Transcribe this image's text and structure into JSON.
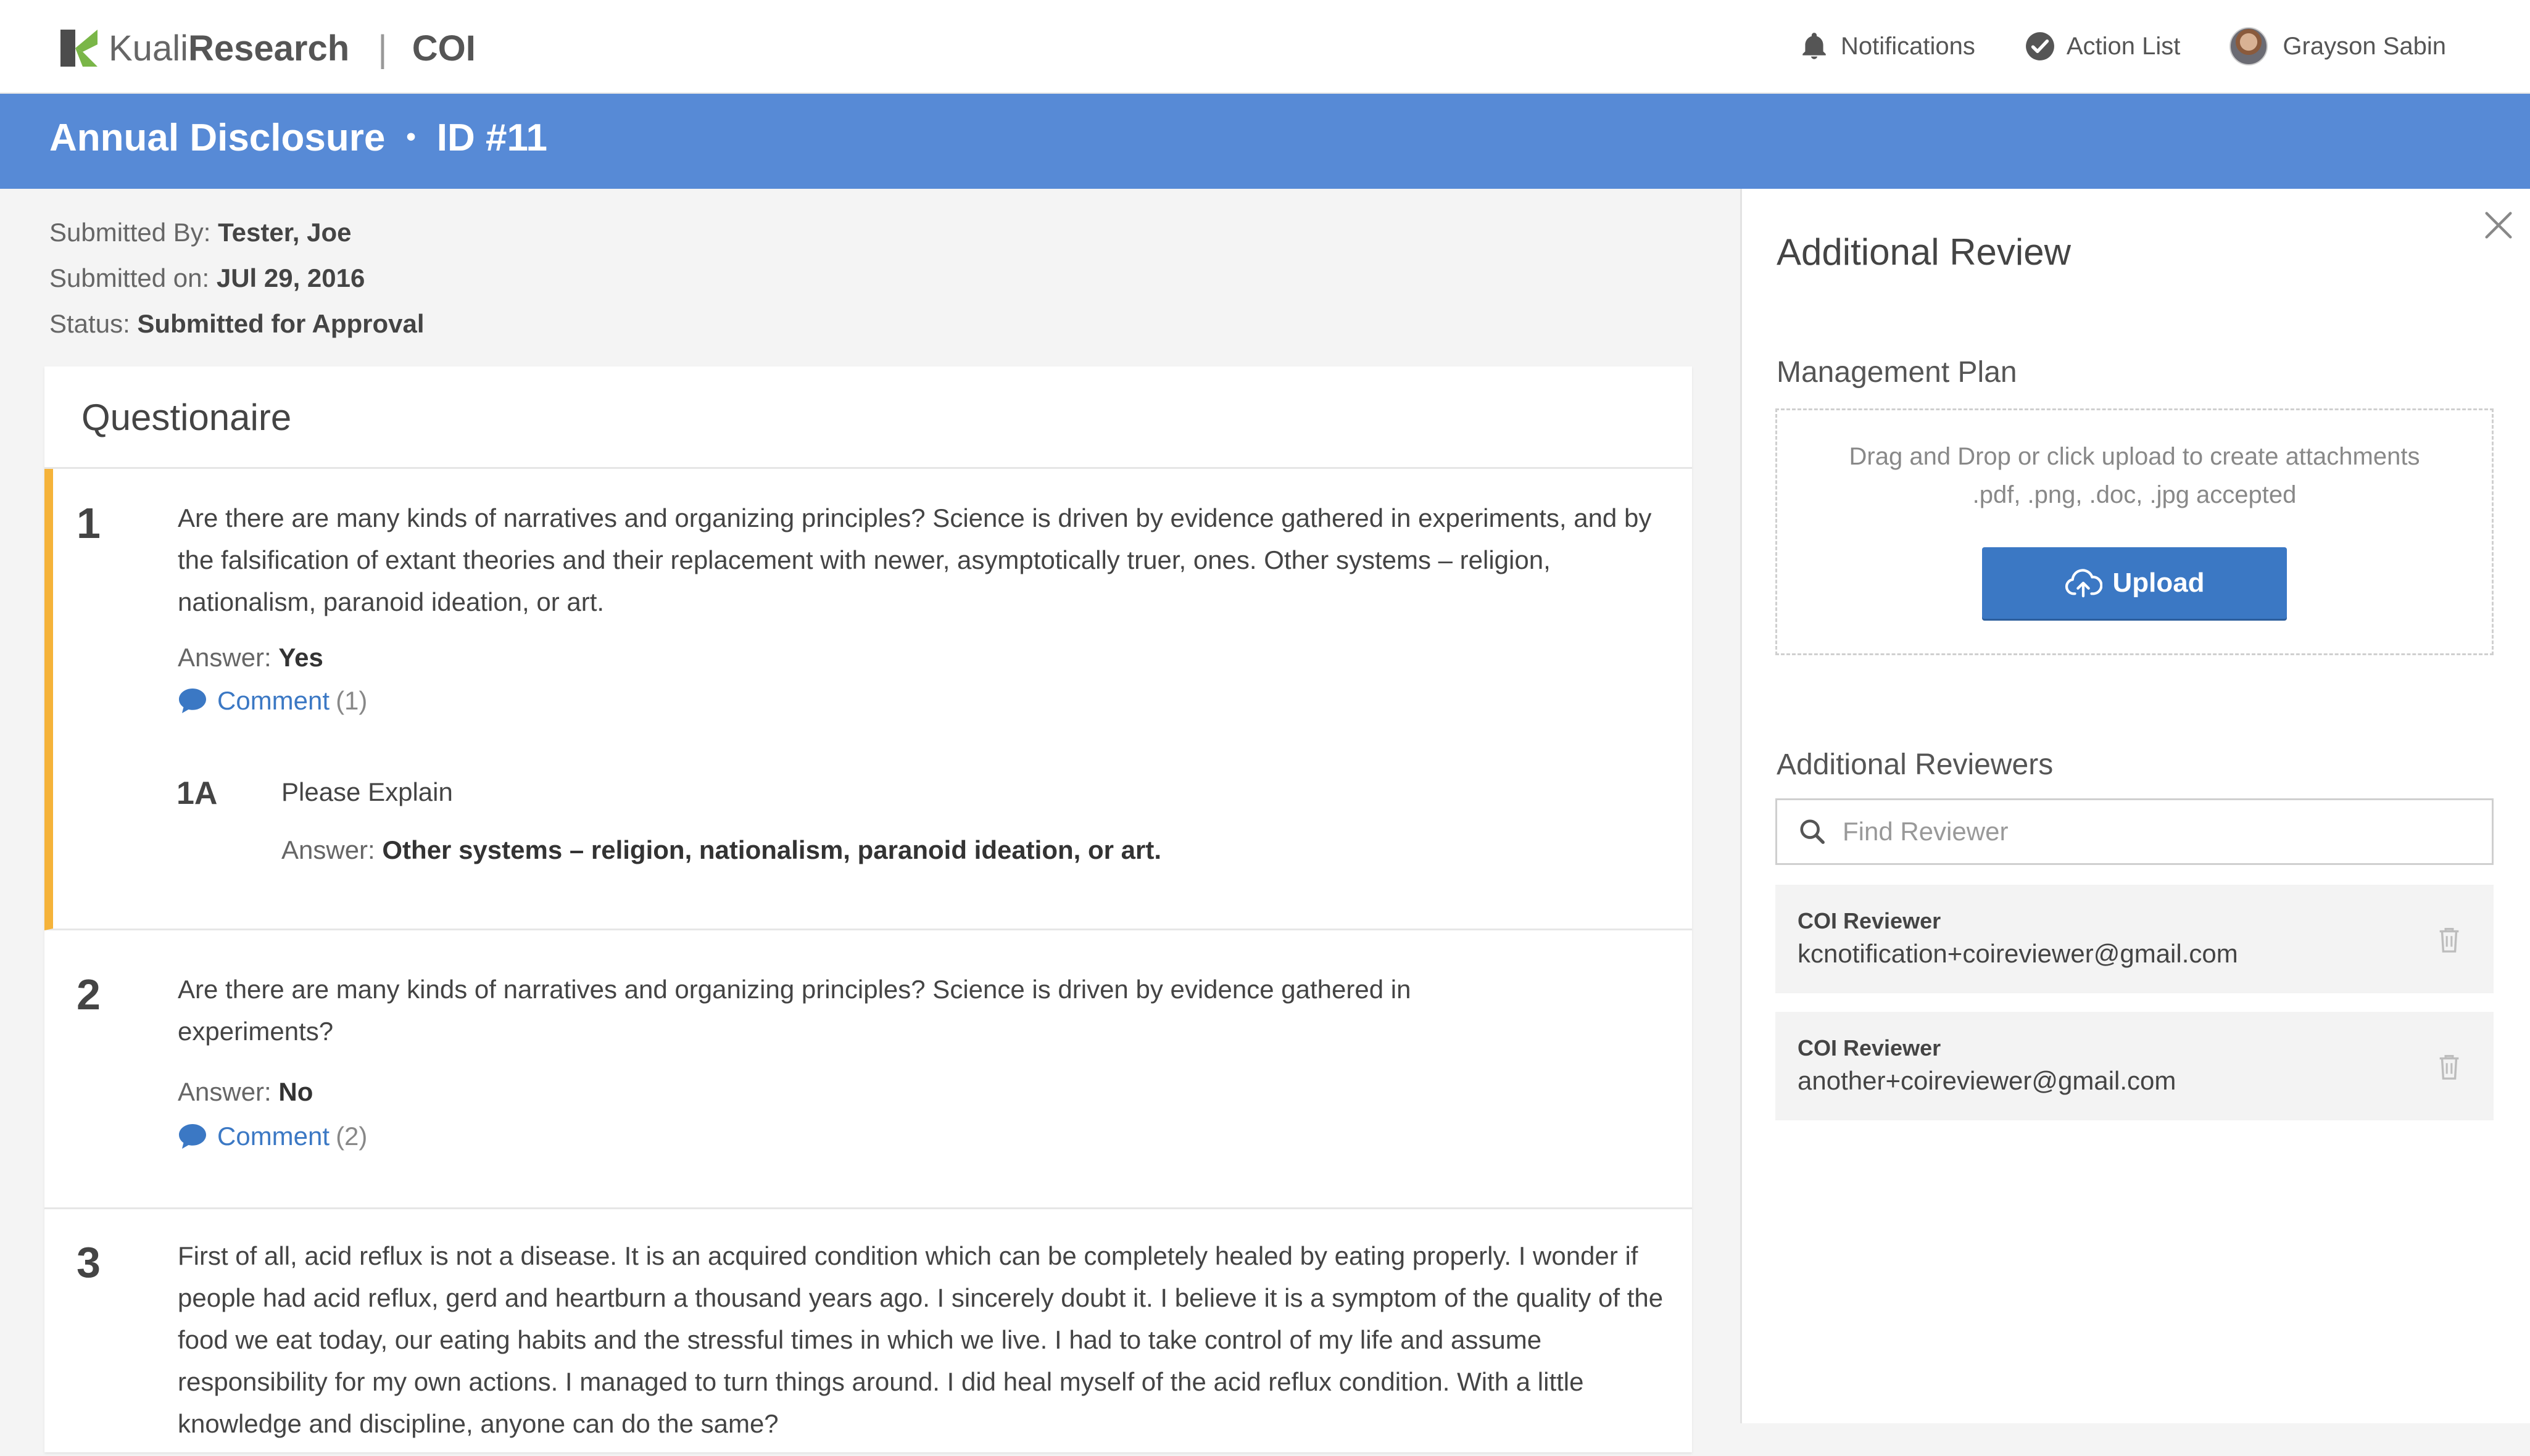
{
  "header": {
    "logo_light": "Kuali",
    "logo_bold": "Research",
    "separator": "|",
    "module": "COI",
    "nav": {
      "notifications": "Notifications",
      "action_list": "Action List",
      "user_name": "Grayson Sabin"
    }
  },
  "titlebar": {
    "title": "Annual Disclosure",
    "separator": "•",
    "id_label": "ID #11"
  },
  "meta": {
    "submitted_by_label": "Submitted By:",
    "submitted_by": "Tester, Joe",
    "submitted_on_label": "Submitted on:",
    "submitted_on": "JUl 29, 2016",
    "status_label": "Status:",
    "status": "Submitted for Approval"
  },
  "questionnaire": {
    "title": "Questionaire",
    "questions": [
      {
        "number": "1",
        "text": "Are there are many kinds of narratives and organizing principles? Science is driven by evidence gathered in experiments, and by the falsification of extant theories and their replacement with newer, asymptotically truer, ones. Other systems – religion, nationalism, paranoid ideation, or art.",
        "answer_label": "Answer:",
        "answer": "Yes",
        "comment_label": "Comment",
        "comment_count": "(1)",
        "sub": {
          "number": "1A",
          "text": "Please Explain",
          "answer_label": "Answer:",
          "answer": "Other systems – religion, nationalism, paranoid ideation, or art."
        }
      },
      {
        "number": "2",
        "text": "Are there are many kinds of narratives and organizing principles? Science is driven by evidence gathered in experiments?",
        "answer_label": "Answer:",
        "answer": "No",
        "comment_label": "Comment",
        "comment_count": "(2)"
      },
      {
        "number": "3",
        "text": "First of all, acid reflux is not a disease.  It is an acquired condition which can be completely healed by eating properly. I wonder if people had acid reflux, gerd and heartburn a thousand years ago. I sincerely doubt it. I believe it is a symptom of the quality of the food we eat today, our eating habits and the stressful times in which we live. I had to take control of my life and assume responsibility for my own actions. I managed to turn things around. I did heal myself of the acid reflux condition. With a little knowledge and discipline, anyone can do the same?"
      }
    ]
  },
  "panel": {
    "title": "Additional Review",
    "management_plan": {
      "label": "Management Plan",
      "drop_line1": "Drag and Drop or click upload to create attachments",
      "drop_line2": ".pdf, .png, .doc, .jpg accepted",
      "upload_label": "Upload"
    },
    "reviewers": {
      "label": "Additional Reviewers",
      "search_placeholder": "Find Reviewer",
      "list": [
        {
          "role": "COI Reviewer",
          "email": "kcnotification+coireviewer@gmail.com"
        },
        {
          "role": "COI Reviewer",
          "email": "another+coireviewer@gmail.com"
        }
      ]
    }
  },
  "colors": {
    "brand_blue": "#578ad6",
    "button_blue": "#3b78c4",
    "active_accent": "#f5b33a",
    "logo_green": "#7ab648"
  },
  "icons": {
    "notifications": "bell-icon",
    "action_list": "check-circle-icon",
    "comment": "speech-bubble-icon",
    "upload": "cloud-upload-icon",
    "search": "search-icon",
    "close": "close-icon",
    "delete": "trash-icon"
  }
}
